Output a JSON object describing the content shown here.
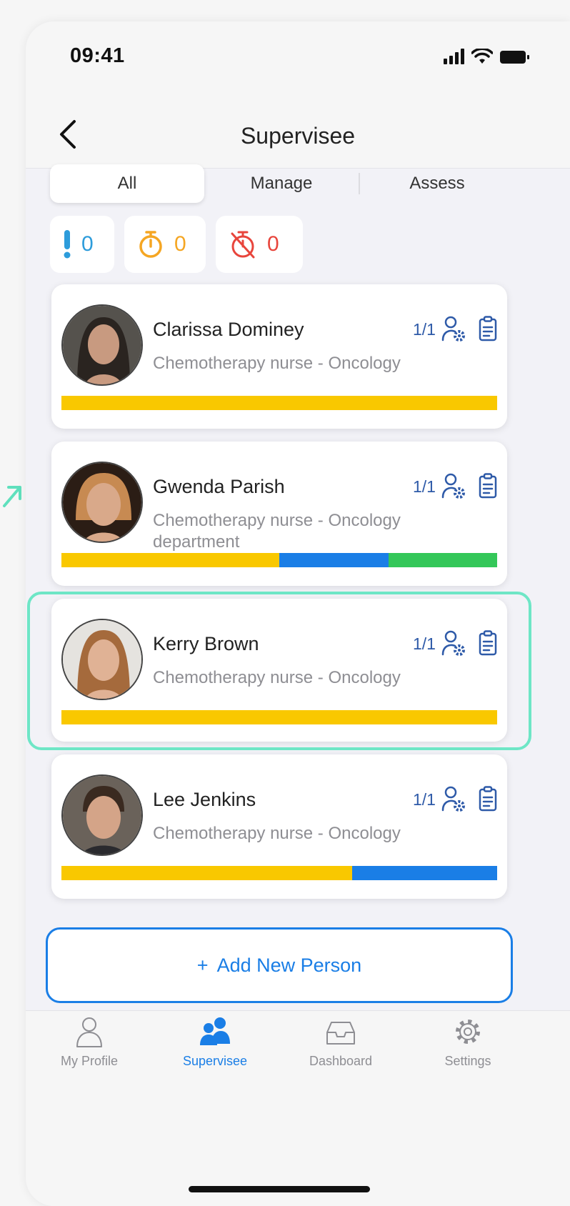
{
  "status_bar": {
    "time": "09:41"
  },
  "header": {
    "title": "Supervisee"
  },
  "segments": {
    "all": "All",
    "manage": "Manage",
    "assess": "Assess",
    "active": "All"
  },
  "counters": [
    {
      "icon": "exclamation-icon",
      "value": "0",
      "color": "#2d9cdb"
    },
    {
      "icon": "timer-icon",
      "value": "0",
      "color": "#f5a623"
    },
    {
      "icon": "timer-off-icon",
      "value": "0",
      "color": "#e8453c"
    }
  ],
  "people": [
    {
      "name": "Clarissa Dominey",
      "role": "Chemotherapy nurse - Oncology",
      "ratio": "1/1",
      "progress": [
        {
          "fraction": 1.0,
          "color": "#f9c800"
        }
      ]
    },
    {
      "name": "Gwenda Parish",
      "role": "Chemotherapy nurse - Oncology department",
      "ratio": "1/1",
      "progress": [
        {
          "fraction": 0.5,
          "color": "#f9c800"
        },
        {
          "fraction": 0.25,
          "color": "#1a7ee6"
        },
        {
          "fraction": 0.25,
          "color": "#34c759"
        }
      ]
    },
    {
      "name": "Kerry Brown",
      "role": "Chemotherapy nurse - Oncology",
      "ratio": "1/1",
      "progress": [
        {
          "fraction": 1.0,
          "color": "#f9c800"
        }
      ]
    },
    {
      "name": "Lee Jenkins",
      "role": "Chemotherapy nurse - Oncology",
      "ratio": "1/1",
      "progress": [
        {
          "fraction": 0.667,
          "color": "#f9c800"
        },
        {
          "fraction": 0.333,
          "color": "#1a7ee6"
        }
      ]
    }
  ],
  "add_button": {
    "plus": "+",
    "label": "Add New Person"
  },
  "tabbar": [
    {
      "label": "My Profile",
      "icon": "person-icon"
    },
    {
      "label": "Supervisee",
      "icon": "group-icon",
      "active": true
    },
    {
      "label": "Dashboard",
      "icon": "inbox-icon"
    },
    {
      "label": "Settings",
      "icon": "gear-icon"
    }
  ],
  "colors": {
    "accent": "#1a7ee6",
    "highlight": "#6ee6c6"
  }
}
